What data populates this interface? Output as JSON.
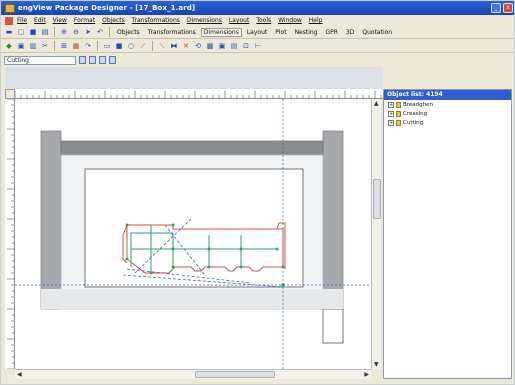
{
  "window": {
    "title": "engView Package Designer - [17_Box_1.ard]"
  },
  "menu": {
    "items": [
      "File",
      "Edit",
      "View",
      "Format",
      "Objects",
      "Transformations",
      "Dimensions",
      "Layout",
      "Tools",
      "Window",
      "Help"
    ]
  },
  "toolbar1": {
    "labels": [
      "Objects",
      "Transformations",
      "Dimensions",
      "Layout",
      "Plot",
      "Nesting",
      "GPR",
      "3D",
      "Quotation"
    ]
  },
  "layer": {
    "selected": "Cutting"
  },
  "object_list": {
    "title": "Object list: 4194",
    "items": [
      "Breadghen",
      "Creasing",
      "Cutting"
    ]
  },
  "colors": {
    "titlebar": "#1f4fc8",
    "cut_line": "#d9503a",
    "crease_line": "#2aa66e",
    "dim_line": "#3a64c8",
    "frame_grey": "#a6a8ab"
  }
}
